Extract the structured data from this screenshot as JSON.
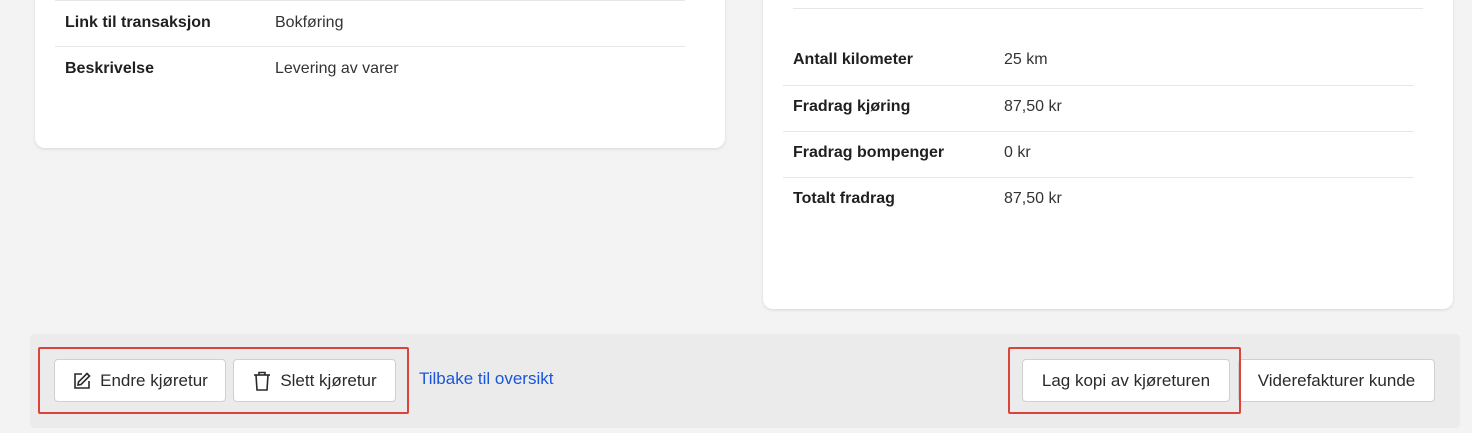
{
  "left_card": {
    "rows": [
      {
        "label": "Link til transaksjon",
        "value": "Bokføring"
      },
      {
        "label": "Beskrivelse",
        "value": "Levering av varer"
      }
    ]
  },
  "right_card": {
    "rows": [
      {
        "label": "Antall kilometer",
        "value": "25 km"
      },
      {
        "label": "Fradrag kjøring",
        "value": "87,50 kr"
      },
      {
        "label": "Fradrag bompenger",
        "value": "0 kr"
      },
      {
        "label": "Totalt fradrag",
        "value": "87,50 kr"
      }
    ]
  },
  "actions": {
    "edit_label": "Endre kjøretur",
    "delete_label": "Slett kjøretur",
    "back_label": "Tilbake til oversikt",
    "copy_label": "Lag kopi av kjøreturen",
    "reinvoice_label": "Viderefakturer kunde"
  },
  "colors": {
    "link": "#1a56db",
    "highlight": "#d9443b",
    "background": "#f3f3f3"
  },
  "icons": {
    "edit": "edit-icon",
    "delete": "trash-icon"
  }
}
